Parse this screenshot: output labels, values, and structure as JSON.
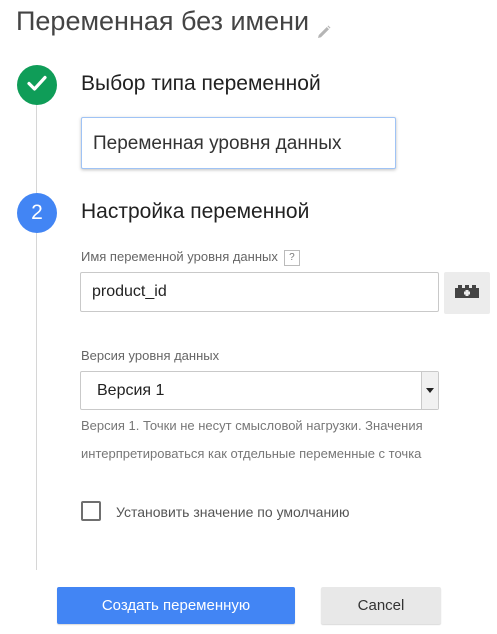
{
  "header": {
    "title": "Переменная без имени",
    "edit_icon": "pencil-icon"
  },
  "steps": [
    {
      "status": "done",
      "icon": "checkmark-icon",
      "title": "Выбор типа переменной",
      "selected_type": "Переменная уровня данных"
    },
    {
      "status": "active",
      "number": "2",
      "title": "Настройка переменной"
    }
  ],
  "config": {
    "name_label": "Имя переменной уровня данных",
    "help_glyph": "?",
    "name_value": "product_id",
    "variable_picker_icon": "lego-brick-icon",
    "version_label": "Версия уровня данных",
    "version_selected": "Версия 1",
    "version_desc_line1": "Версия 1. Точки не несут смысловой нагрузки. Значения",
    "version_desc_line2": "интерпретироваться как отдельные переменные с точка",
    "default_value_label": "Установить значение по умолчанию",
    "default_value_checked": false
  },
  "actions": {
    "create_label": "Создать переменную",
    "cancel_label": "Cancel"
  },
  "colors": {
    "done": "#0f9d58",
    "active": "#4285f4",
    "primary_button": "#4285f4"
  }
}
